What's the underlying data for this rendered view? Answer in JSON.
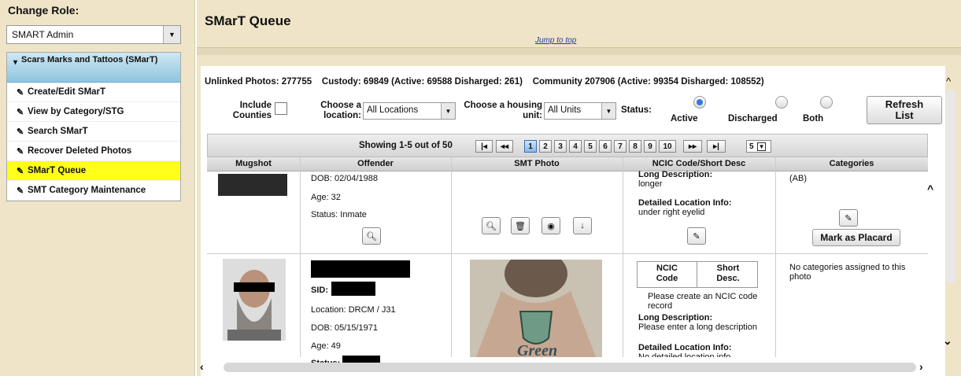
{
  "sidebar": {
    "change_role_label": "Change Role:",
    "role_value": "SMART Admin",
    "section_title": "Scars Marks and Tattoos (SMarT)",
    "items": [
      {
        "label": "Create/Edit SMarT"
      },
      {
        "label": "View by Category/STG"
      },
      {
        "label": "Search SMarT"
      },
      {
        "label": "Recover Deleted Photos"
      },
      {
        "label": "SMarT Queue"
      },
      {
        "label": "SMT Category Maintenance"
      }
    ]
  },
  "header": {
    "title": "SMarT Queue",
    "jump_link": "Jump to top"
  },
  "stats": {
    "text": "Unlinked Photos: 277755    Custody: 69849 (Active: 69588 Disharged: 261)    Community 207906 (Active: 99354 Disharged: 108552)"
  },
  "filters": {
    "include_counties": "Include Counties",
    "location_label": "Choose a location:",
    "location_value": "All Locations",
    "housing_label": "Choose a housing unit:",
    "housing_value": "All Units",
    "status_label": "Status:",
    "status_options": [
      "Active",
      "Discharged",
      "Both"
    ],
    "refresh": "Refresh List"
  },
  "pager": {
    "showing": "Showing 1-5 out of 50",
    "pages": [
      "1",
      "2",
      "3",
      "4",
      "5",
      "6",
      "7",
      "8",
      "9",
      "10"
    ],
    "page_size": "5"
  },
  "table": {
    "headers": [
      "Mugshot",
      "Offender",
      "SMT Photo",
      "NCIC Code/Short Desc",
      "Categories"
    ],
    "row1": {
      "dob": "DOB: 02/04/1988",
      "age": "Age: 32",
      "status": "Status: Inmate",
      "long_desc_label": "Long Description:",
      "long_desc": "longer",
      "loc_label": "Detailed Location Info:",
      "loc": "under right eyelid",
      "category": "(AB)",
      "placard": "Mark as Placard"
    },
    "row2": {
      "sid": "SID:",
      "location": "Location: DRCM / J31",
      "dob": "DOB: 05/15/1971",
      "age": "Age: 49",
      "status": "Status:",
      "ncic_tab": "NCIC Code",
      "short_tab": "Short Desc.",
      "ncic_msg": "Please create an NCIC code record",
      "long_desc_label": "Long Description:",
      "long_desc": "Please enter a long description",
      "loc_label": "Detailed Location Info:",
      "loc": "No detailed location info",
      "categories": "No categories assigned to this photo",
      "tattoo_text": "Green"
    }
  }
}
